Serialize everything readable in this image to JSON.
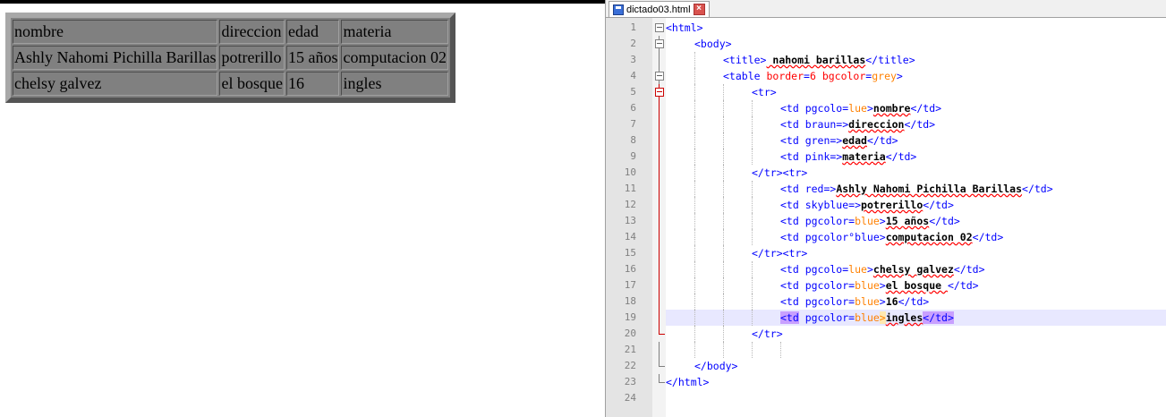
{
  "render": {
    "rows": [
      [
        "nombre",
        "direccion",
        "edad",
        "materia"
      ],
      [
        "Ashly Nahomi Pichilla Barillas",
        "potrerillo",
        "15 años",
        "computacion 02"
      ],
      [
        "chelsy galvez",
        "el bosque",
        "16",
        "ingles"
      ]
    ]
  },
  "editor": {
    "tab_label": "dictado03.html",
    "line_numbers": [
      "1",
      "2",
      "3",
      "4",
      "5",
      "6",
      "7",
      "8",
      "9",
      "10",
      "11",
      "12",
      "13",
      "14",
      "15",
      "16",
      "17",
      "18",
      "19",
      "20",
      "21",
      "22",
      "23",
      "24"
    ],
    "code": {
      "l1": "<html>",
      "l2": "<body>",
      "l3_open": "<title>",
      "l3_text": " nahomi barillas",
      "l3_close": "</title>",
      "l4_tag": "<table ",
      "l4_attr1": "border",
      "l4_eq1": "=",
      "l4_val1": "6",
      "l4_attr2": " bgcolor",
      "l4_eq2": "=",
      "l4_val2": "grey",
      "l4_end": ">",
      "l5": "<tr>",
      "l6_tag": "<td pgcolo=",
      "l6_val": "lue",
      "l6_gt": ">",
      "l6_text": "nombre",
      "l6_close": "</td>",
      "l7_tag": "<td braun=>",
      "l7_text": "direccion",
      "l7_close": "</td>",
      "l8_tag": "<td gren=>",
      "l8_text": "edad",
      "l8_close": "</td>",
      "l9_tag": "<td pink=>",
      "l9_text": "materia",
      "l9_close": "</td>",
      "l10": "</tr><tr>",
      "l11_tag": "<td red=>",
      "l11_text": "Ashly Nahomi Pichilla Barillas",
      "l11_close": "</td>",
      "l12_tag": "<td skyblue=>",
      "l12_text": "potrerillo",
      "l12_close": "</td>",
      "l13_tag": "<td pgcolor=",
      "l13_val": "blue",
      "l13_gt": ">",
      "l13_text": "15 años",
      "l13_close": "</td>",
      "l14_tag": "<td pgcolor°blue>",
      "l14_text": "computacion 02",
      "l14_close": "</td>",
      "l15": "</tr><tr>",
      "l16_tag": "<td pgcolo=",
      "l16_val": "lue",
      "l16_gt": ">",
      "l16_text": "chelsy galvez",
      "l16_close": "</td>",
      "l17_tag": "<td pgcolor=",
      "l17_val": "blue",
      "l17_gt": ">",
      "l17_text": "el bosque ",
      "l17_close": "</td>",
      "l18_tag": "<td pgcolor=",
      "l18_val": "blue",
      "l18_gt": ">",
      "l18_text": "16",
      "l18_close": "</td>",
      "l19_tag": "<td",
      "l19_attr": " pgcolor=",
      "l19_val": "blue",
      "l19_gt": ">",
      "l19_text": "ingles",
      "l19_close": "</td>",
      "l20": "</tr>",
      "l22": "</body>",
      "l23": "</html>"
    }
  }
}
